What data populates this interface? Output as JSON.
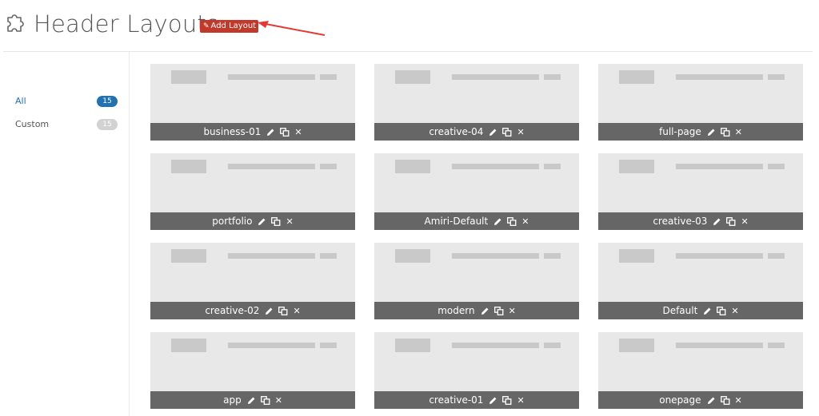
{
  "header": {
    "title": "Header Layouts",
    "add_button_label": "Add Layout",
    "accent_color": "#c0392b"
  },
  "sidebar": {
    "filters": [
      {
        "label": "All",
        "count": "15",
        "active": true
      },
      {
        "label": "Custom",
        "count": "15",
        "active": false
      }
    ]
  },
  "layouts": [
    {
      "name": "business-01"
    },
    {
      "name": "creative-04"
    },
    {
      "name": "full-page"
    },
    {
      "name": "portfolio"
    },
    {
      "name": "Amiri-Default"
    },
    {
      "name": "creative-03"
    },
    {
      "name": "creative-02"
    },
    {
      "name": "modern"
    },
    {
      "name": "Default"
    },
    {
      "name": "app"
    },
    {
      "name": "creative-01"
    },
    {
      "name": "onepage"
    }
  ],
  "icons": {
    "title_icon": "puzzle-icon",
    "add_button_icon": "link-icon",
    "edit_icon": "pencil-icon",
    "duplicate_icon": "copy-icon",
    "delete_icon": "close-icon"
  }
}
